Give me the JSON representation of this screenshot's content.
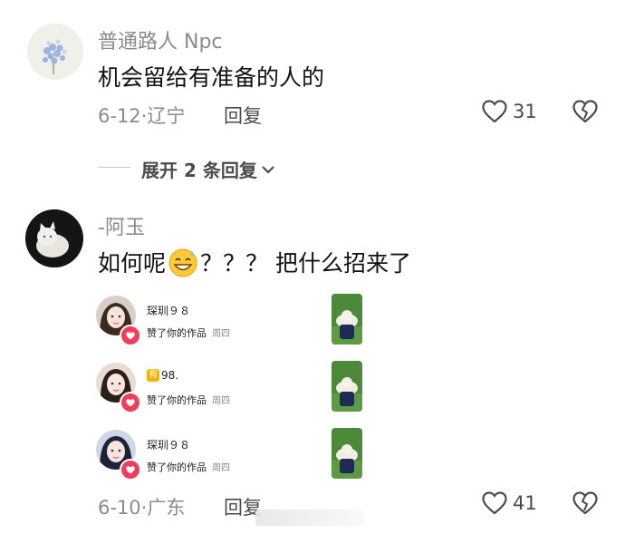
{
  "comments": [
    {
      "username": "普通路人 Npc",
      "text": "机会留给有准备的人的",
      "date_location": "6-12·辽宁",
      "reply_label": "回复",
      "likes": "31"
    },
    {
      "username": "-阿玉",
      "text_before_emoji": "如何呢",
      "text_after_emoji": "？？？ 把什么招来了",
      "emoji": "grinning-sweat-emoji",
      "date_location": "6-10·广东",
      "reply_label": "回复",
      "likes": "41"
    }
  ],
  "expand_replies_label": "展开 2 条回复",
  "notifications": [
    {
      "name": "琛玔９８",
      "action": "赞了你的作品",
      "time": "周四"
    },
    {
      "name_badge": "有",
      "name": "98.",
      "action": "赞了你的作品",
      "time": "周四"
    },
    {
      "name": "琛玔９８",
      "action": "赞了你的作品",
      "time": "周四"
    }
  ],
  "colors": {
    "accent_red": "#f23c5c",
    "meta_gray": "#8a8a8f",
    "badge_yellow": "#f5b400"
  }
}
